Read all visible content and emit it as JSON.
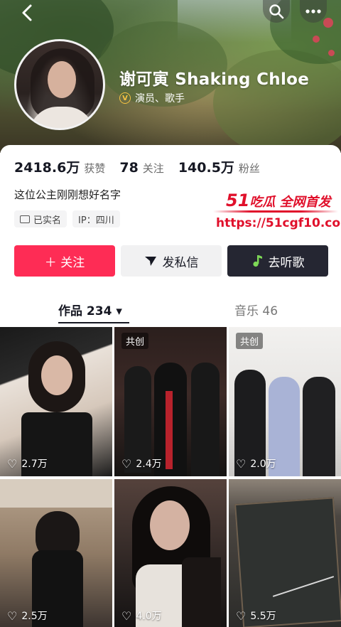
{
  "header": {
    "back_icon": "chevron-left-icon",
    "search_icon": "search-icon",
    "more_icon": "more-dots-icon"
  },
  "profile": {
    "name": "谢可寅 Shaking Chloe",
    "verified_label": "演员、歌手",
    "verified_icon": "verified-v-icon"
  },
  "stats": [
    {
      "value": "2418.6万",
      "label": "获赞"
    },
    {
      "value": "78",
      "label": "关注"
    },
    {
      "value": "140.5万",
      "label": "粉丝"
    }
  ],
  "bio": "这位公主刚刚想好名字",
  "tags": [
    {
      "label": "已实名",
      "icon": "id-card-icon"
    },
    {
      "label": "IP：四川"
    }
  ],
  "watermark": {
    "line1_big": "51",
    "line1_rest": "吃瓜 全网首发",
    "line2": "https://51cgf10.com"
  },
  "actions": {
    "follow": "＋ 关注",
    "message": "发私信",
    "music": "去听歌"
  },
  "tabs": {
    "works": "作品 234 ▾",
    "music": "音乐 46"
  },
  "videos": [
    {
      "likes": "2.7万",
      "collab": ""
    },
    {
      "likes": "2.4万",
      "collab": "共创"
    },
    {
      "likes": "2.0万",
      "collab": "共创"
    },
    {
      "likes": "2.5万",
      "collab": ""
    },
    {
      "likes": "4.0万",
      "collab": ""
    },
    {
      "likes": "5.5万",
      "collab": ""
    }
  ],
  "colors": {
    "follow_button": "#fe2c55",
    "music_button": "#252632",
    "message_button": "#f1f1f2",
    "watermark": "#e0102b"
  }
}
